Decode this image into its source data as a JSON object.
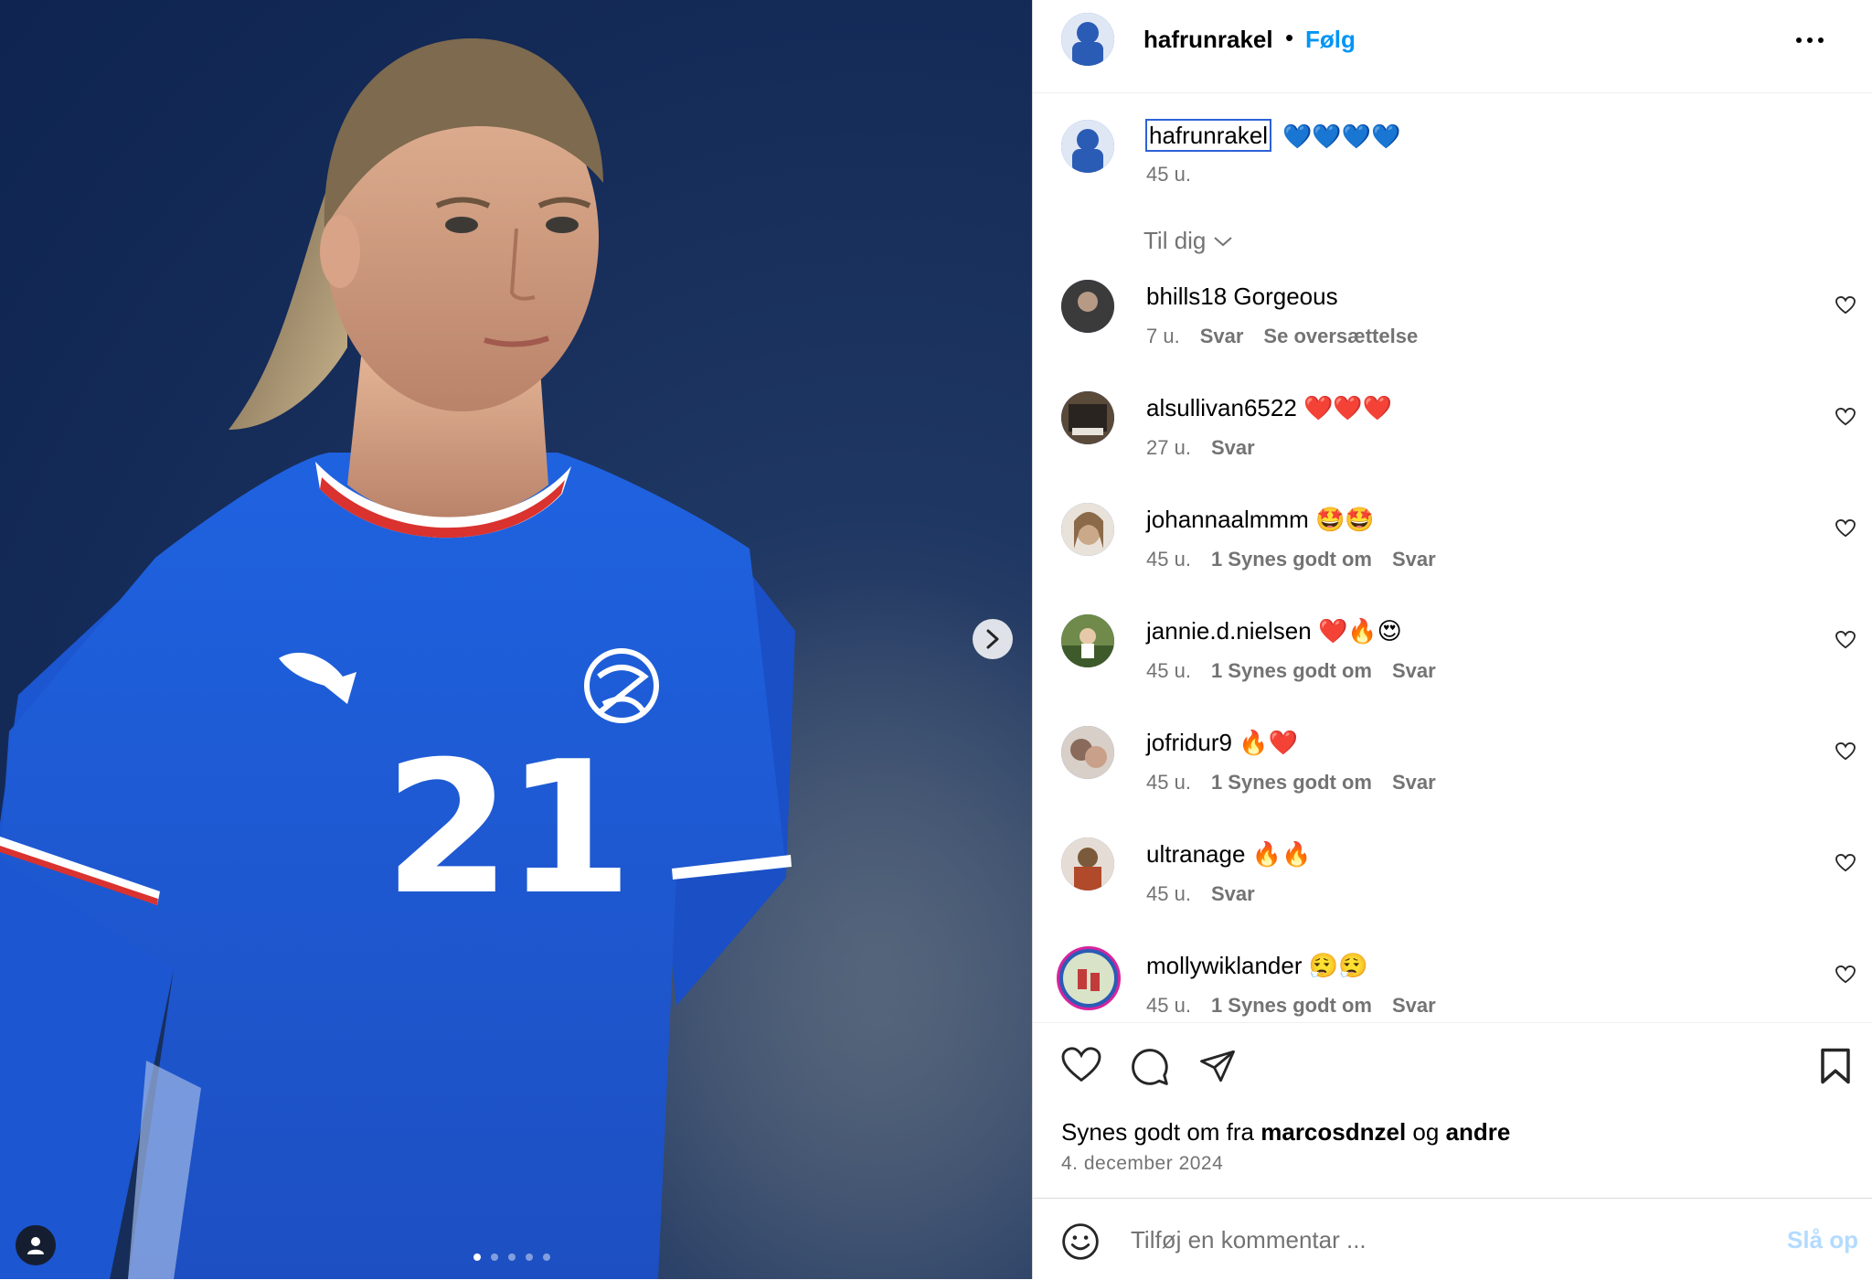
{
  "post": {
    "author": "hafrunrakel",
    "follow_label": "Følg",
    "separator": "•",
    "caption_username": "hafrunrakel",
    "caption_text": "💙💙💙💙",
    "caption_time": "45 u.",
    "sort_label": "Til dig",
    "carousel": {
      "total": 5,
      "active": 1
    }
  },
  "comments": [
    {
      "user": "bhills18",
      "text": "Gorgeous",
      "time": "7 u.",
      "likes": "",
      "reply": "Svar",
      "translate": "Se oversættelse",
      "avatar_color": "#3b3b3b"
    },
    {
      "user": "alsullivan6522",
      "text": "❤️❤️❤️",
      "time": "27 u.",
      "likes": "",
      "reply": "Svar",
      "translate": "",
      "avatar_color": "#5a4a3a"
    },
    {
      "user": "johannaalmmm",
      "text": "🤩🤩",
      "time": "45 u.",
      "likes": "1 Synes godt om",
      "reply": "Svar",
      "translate": "",
      "avatar_color": "#c9a98a"
    },
    {
      "user": "jannie.d.nielsen",
      "text": "❤️🔥😍",
      "time": "45 u.",
      "likes": "1 Synes godt om",
      "reply": "Svar",
      "translate": "",
      "avatar_color": "#6f8a4a"
    },
    {
      "user": "jofridur9",
      "text": "🔥❤️",
      "time": "45 u.",
      "likes": "1 Synes godt om",
      "reply": "Svar",
      "translate": "",
      "avatar_color": "#8a6a5a"
    },
    {
      "user": "ultranage",
      "text": "🔥🔥",
      "time": "45 u.",
      "likes": "",
      "reply": "Svar",
      "translate": "",
      "avatar_color": "#7a5a3a"
    },
    {
      "user": "mollywiklander",
      "text": "😮‍💨😮‍💨",
      "time": "45 u.",
      "likes": "1 Synes godt om",
      "reply": "Svar",
      "translate": "",
      "avatar_color": "#c23b3b"
    }
  ],
  "likes": {
    "prefix": "Synes godt om fra",
    "user": "marcosdnzel",
    "conjunction": "og",
    "others": "andre"
  },
  "date": "4. december 2024",
  "composer": {
    "placeholder": "Tilføj en kommentar ...",
    "post_label": "Slå op"
  },
  "colors": {
    "accent": "#0095f6",
    "muted": "#737373",
    "post_disabled": "#b3dbff"
  }
}
